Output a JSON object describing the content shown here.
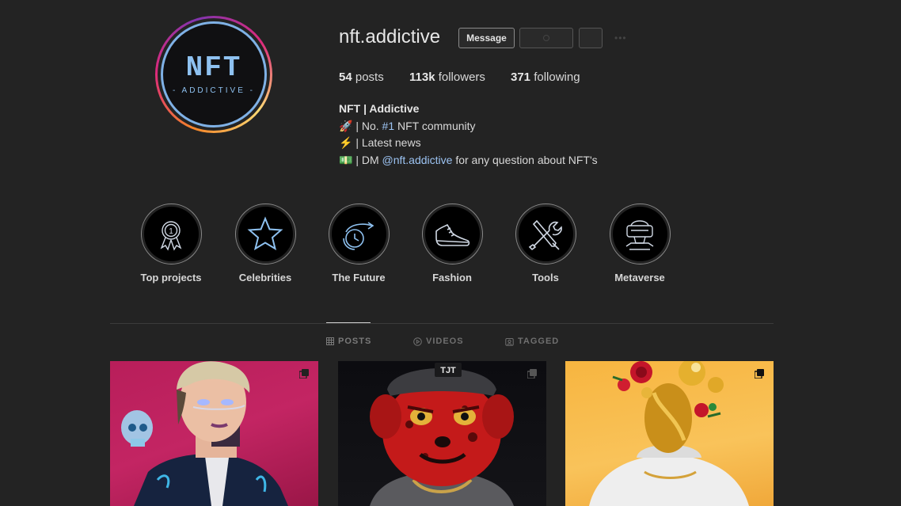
{
  "profile": {
    "username": "nft.addictive",
    "logo_main": "NFT",
    "logo_sub": "- ADDICTIVE -",
    "message_button": "Message",
    "more_label": "•••"
  },
  "stats": {
    "posts_count": "54",
    "posts_label": "posts",
    "followers_count": "113k",
    "followers_label": "followers",
    "following_count": "371",
    "following_label": "following"
  },
  "bio": {
    "name": "NFT | Addictive",
    "line1_emoji": "🚀",
    "line1_text_a": " | No. ",
    "line1_hashtag": "#1",
    "line1_text_b": " NFT community",
    "line2_emoji": "⚡",
    "line2_text": " | Latest news",
    "line3_emoji": "💵",
    "line3_text_a": " | DM ",
    "line3_mention": "@nft.addictive",
    "line3_text_b": " for any question about NFT's"
  },
  "highlights": [
    {
      "label": "Top projects",
      "icon": "award-ribbon-icon"
    },
    {
      "label": "Celebrities",
      "icon": "star-icon"
    },
    {
      "label": "The Future",
      "icon": "clock-arrow-icon"
    },
    {
      "label": "Fashion",
      "icon": "sneaker-icon"
    },
    {
      "label": "Tools",
      "icon": "tools-icon"
    },
    {
      "label": "Metaverse",
      "icon": "vr-headset-icon"
    }
  ],
  "tabs": [
    {
      "label": "POSTS",
      "icon": "grid-icon",
      "active": true
    },
    {
      "label": "VIDEOS",
      "icon": "play-icon",
      "active": false
    },
    {
      "label": "TAGGED",
      "icon": "tag-icon",
      "active": false
    }
  ],
  "posts": [
    {
      "name": "cyberpunk-avatar-post",
      "badge": "multiple-posts-icon"
    },
    {
      "name": "red-cat-tjt-post",
      "cap_text": "TJT",
      "badge": "multiple-posts-icon"
    },
    {
      "name": "golden-head-roses-post",
      "badge": "multiple-posts-icon"
    }
  ],
  "colors": {
    "background": "#232323",
    "link": "#9cc3f2",
    "logo_blue": "#8ec1f0"
  }
}
